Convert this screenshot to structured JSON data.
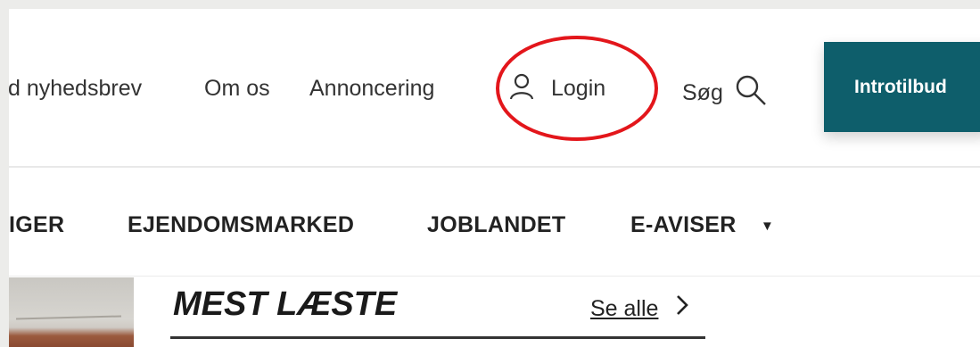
{
  "topnav": {
    "newsletter": "d nyhedsbrev",
    "about": "Om os",
    "ads": "Annoncering",
    "login": "Login",
    "search": "Søg",
    "intro_button": "Introtilbud"
  },
  "sections": {
    "items": [
      "IGER",
      "EJENDOMSMARKED",
      "JOBLANDET",
      "E-AVISER"
    ],
    "dropdown_caret": "▼"
  },
  "most_read": {
    "title": "MEST LÆSTE",
    "see_all": "Se alle"
  },
  "colors": {
    "accent": "#0e5e6b",
    "annotation_ring": "#e3161b"
  },
  "icons": [
    "user-icon",
    "search-icon",
    "chevron-right-icon",
    "caret-down-icon"
  ]
}
